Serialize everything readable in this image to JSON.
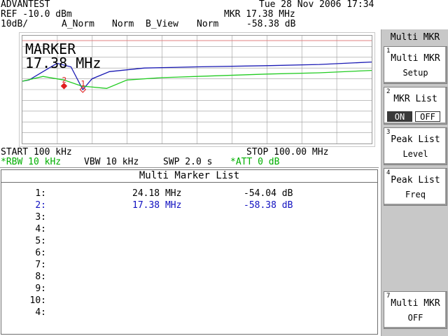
{
  "header": {
    "brand": "ADVANTEST",
    "datetime": "Tue 28 Nov 2006 17:34",
    "ref": "REF -10.0 dBm",
    "scale": "10dB/",
    "trace_a": "A_Norm",
    "trace_a_mode": "Norm",
    "trace_b": "B_View",
    "trace_b_mode": "Norm",
    "mkr_freq": "MKR 17.38 MHz",
    "mkr_level": "-58.38 dB"
  },
  "plot": {
    "marker_title": "MARKER",
    "marker_value": "17.38 MHz",
    "marker_labels": [
      "1",
      "2"
    ],
    "colors": {
      "trace_a": "#1a1ab4",
      "trace_b": "#22cc22",
      "marker": "#e02020",
      "grid": "#9a9a9a",
      "ref_line": "#e08080"
    }
  },
  "chart_data": {
    "type": "line",
    "xlim": [
      0.1,
      100.0
    ],
    "ylim": [
      -100,
      -10
    ],
    "grid": true,
    "series": [
      {
        "x": [
          0.1,
          2.0,
          6.0,
          10.0,
          14.0,
          17.38,
          20.0,
          25.0,
          35.0,
          50.0,
          70.0,
          85.0,
          100.0
        ],
        "y": [
          -48,
          -47,
          -40,
          -33,
          -36,
          -55,
          -46,
          -40,
          -37,
          -36,
          -35,
          -34,
          -32
        ]
      },
      {
        "x": [
          0.1,
          6.0,
          12.0,
          17.0,
          24.18,
          30.0,
          40.0,
          50.0,
          70.0,
          85.0,
          100.0
        ],
        "y": [
          -48,
          -44,
          -47,
          -52,
          -54,
          -47,
          -45,
          -44,
          -42,
          -41,
          -39
        ]
      }
    ]
  },
  "sweep": {
    "start": "START 100 kHz",
    "stop": "STOP 100.00 MHz",
    "rbw": "*RBW 10 kHz",
    "vbw": "VBW 10 kHz",
    "swp": "SWP 2.0 s",
    "att": "*ATT 0 dB"
  },
  "marker_list": {
    "title": "Multi Marker List",
    "rows": [
      {
        "idx": "1:",
        "freq": "24.18 MHz",
        "level": "-54.04 dB",
        "active": false
      },
      {
        "idx": "2:",
        "freq": "17.38 MHz",
        "level": "-58.38 dB",
        "active": true
      },
      {
        "idx": "3:",
        "freq": "",
        "level": "",
        "active": false
      },
      {
        "idx": "4:",
        "freq": "",
        "level": "",
        "active": false
      },
      {
        "idx": "5:",
        "freq": "",
        "level": "",
        "active": false
      },
      {
        "idx": "6:",
        "freq": "",
        "level": "",
        "active": false
      },
      {
        "idx": "7:",
        "freq": "",
        "level": "",
        "active": false
      },
      {
        "idx": "8:",
        "freq": "",
        "level": "",
        "active": false
      },
      {
        "idx": "9:",
        "freq": "",
        "level": "",
        "active": false
      },
      {
        "idx": "10:",
        "freq": "",
        "level": "",
        "active": false
      },
      {
        "idx": "4:",
        "freq": "",
        "level": "",
        "active": false
      }
    ]
  },
  "softkeys": {
    "title": "Multi MKR",
    "keys": [
      {
        "num": "1",
        "line1": "Multi MKR",
        "line2": "Setup"
      },
      {
        "num": "2",
        "line1": "MKR List",
        "on": "ON",
        "off": "OFF"
      },
      {
        "num": "3",
        "line1": "Peak List",
        "line2": "Level"
      },
      {
        "num": "4",
        "line1": "Peak List",
        "line2": "Freq"
      },
      {
        "num": "7",
        "line1": "Multi MKR",
        "line2": "OFF"
      }
    ]
  }
}
